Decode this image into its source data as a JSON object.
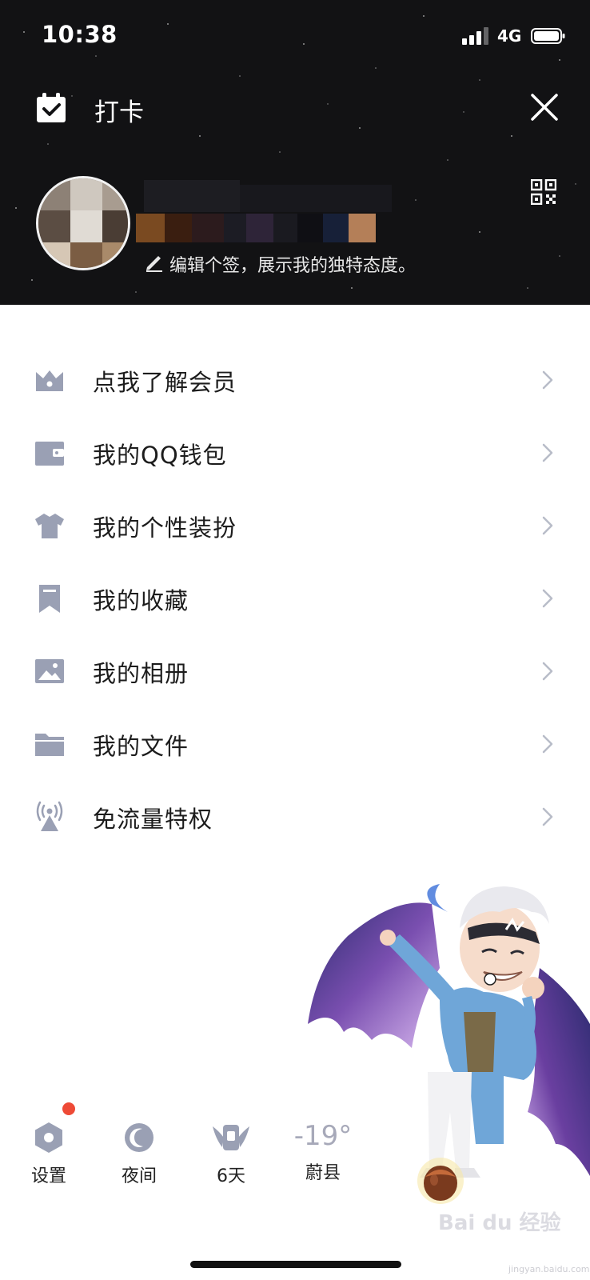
{
  "status_bar": {
    "time": "10:38",
    "network": "4G"
  },
  "header": {
    "checkin_label": "打卡",
    "signature": "编辑个签，展示我的独特态度。"
  },
  "menu": {
    "items": [
      {
        "label": "点我了解会员",
        "icon": "crown-icon"
      },
      {
        "label": "我的QQ钱包",
        "icon": "wallet-icon"
      },
      {
        "label": "我的个性装扮",
        "icon": "shirt-icon"
      },
      {
        "label": "我的收藏",
        "icon": "bookmark-icon"
      },
      {
        "label": "我的相册",
        "icon": "image-icon"
      },
      {
        "label": "我的文件",
        "icon": "folder-icon"
      },
      {
        "label": "免流量特权",
        "icon": "antenna-icon"
      }
    ]
  },
  "toolbar": {
    "settings_label": "设置",
    "night_label": "夜间",
    "days_label": "6天",
    "temperature": "-19°",
    "location": "蔚县"
  },
  "colors": {
    "header_bg": "#121214",
    "icon_gray": "#9aa0b4",
    "badge_red": "#ee4a36"
  },
  "watermark": {
    "text": "Bai du 经验",
    "sub": "jingyan.baidu.com"
  }
}
